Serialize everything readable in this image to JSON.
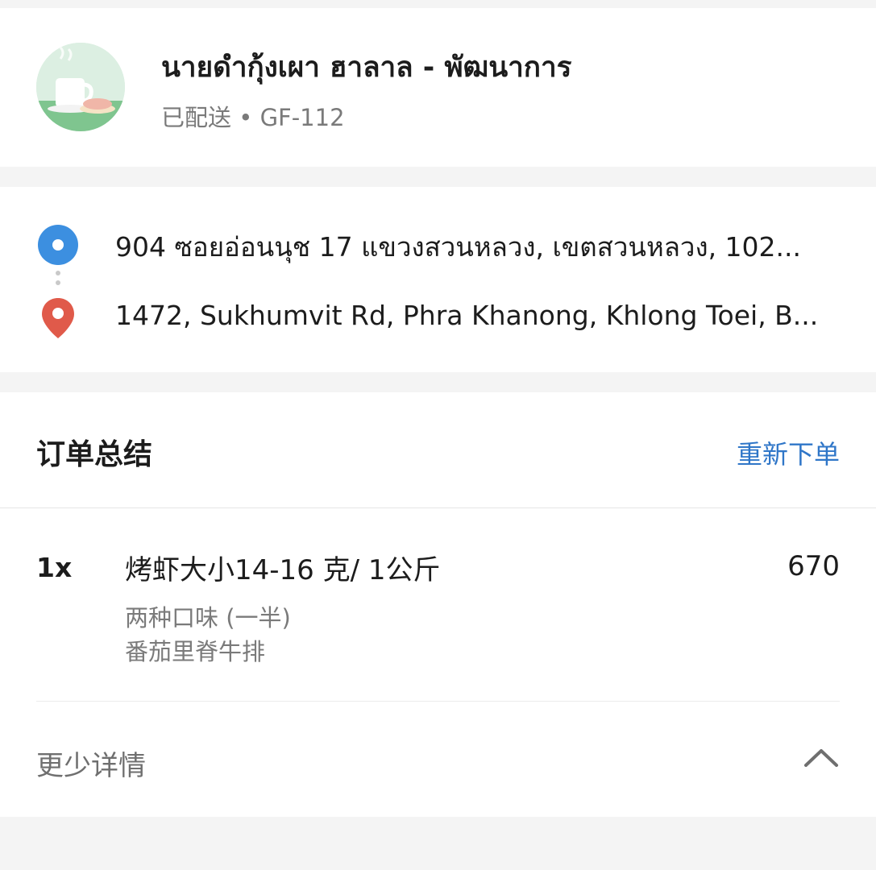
{
  "header": {
    "store_name": "นายดำกุ้งเผา ฮาลาล - พัฒนาการ",
    "status": "已配送",
    "separator": "•",
    "order_code": "GF-112",
    "avatar_icon": "coffee-cup-icon"
  },
  "addresses": {
    "pickup": "904 ซอยอ่อนนุช 17 แขวงสวนหลวง, เขตสวนหลวง, 102...",
    "dropoff": "1472, Sukhumvit Rd, Phra Khanong, Khlong Toei, B...",
    "pickup_icon": "pickup-dot-icon",
    "dropoff_icon": "location-pin-icon",
    "colors": {
      "pickup": "#3c8fe0",
      "dropoff": "#e05a4a"
    }
  },
  "summary": {
    "title": "订单总结",
    "reorder_label": "重新下单",
    "items": [
      {
        "qty": "1x",
        "name": "烤虾大小14-16 克/ 1公斤",
        "price": "670",
        "options": [
          "两种口味 (一半)",
          "番茄里脊牛排"
        ]
      }
    ],
    "less_details_label": "更少详情",
    "collapse_icon": "chevron-up-icon"
  },
  "colors": {
    "accent": "#2f76c8",
    "muted_text": "#7a7a7a",
    "background": "#f4f4f4"
  }
}
